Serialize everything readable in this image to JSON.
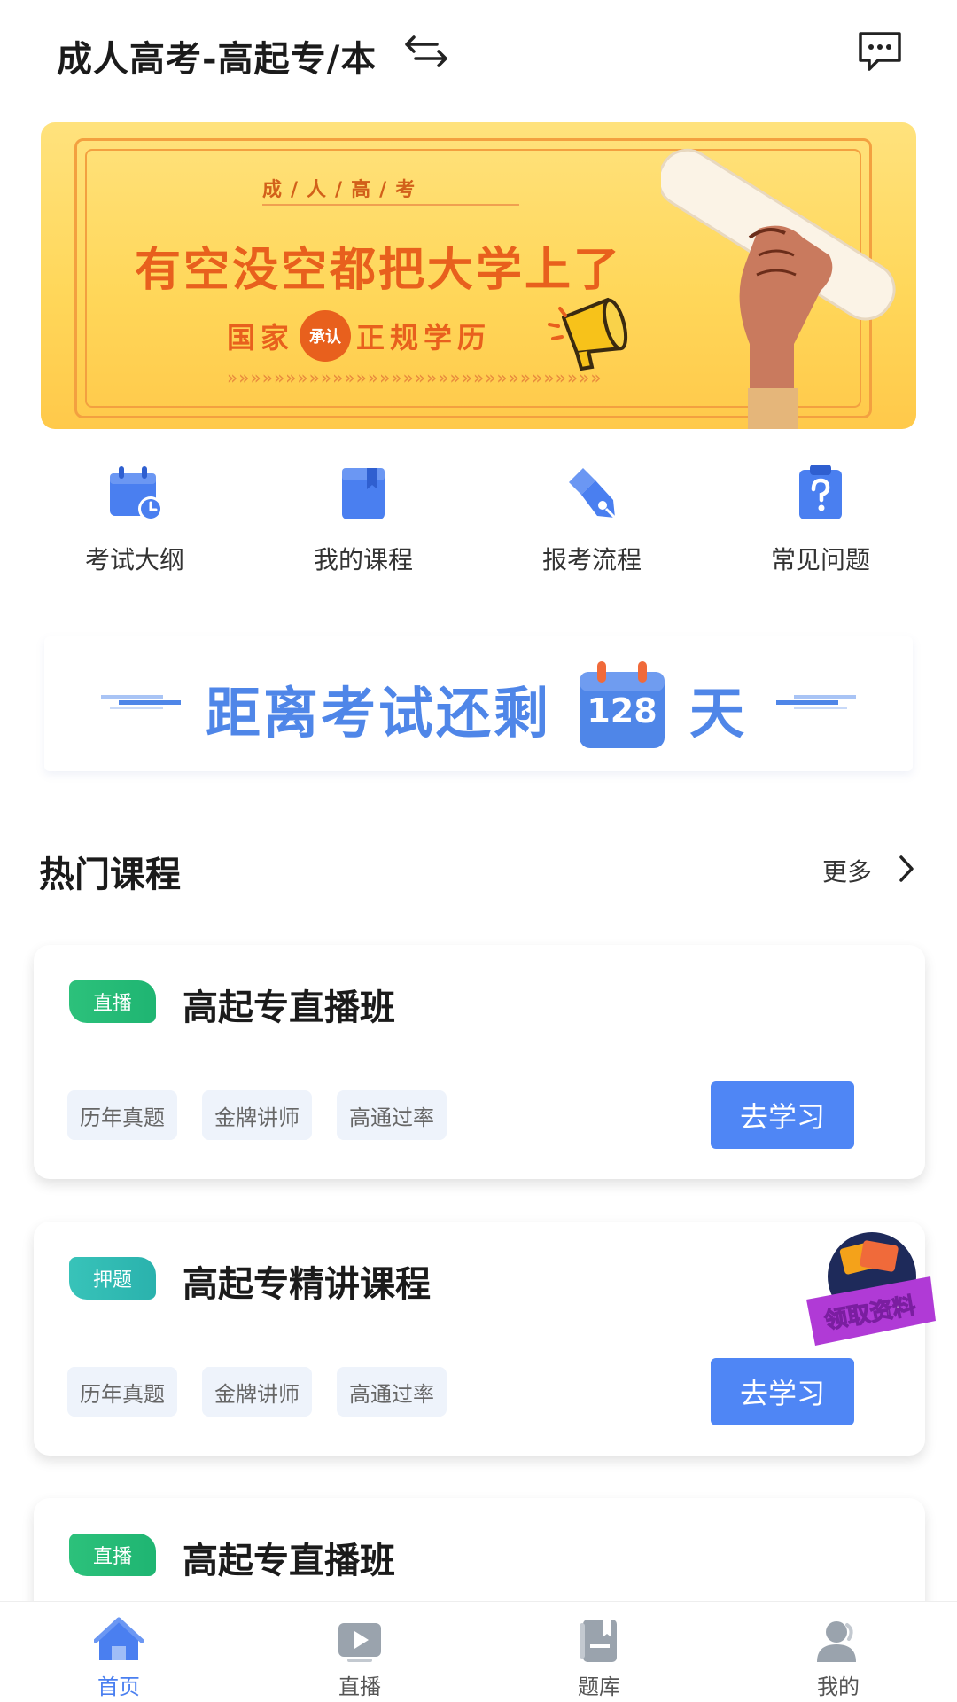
{
  "header": {
    "title": "成人高考-高起专/本",
    "switch_icon": "switch-arrows-icon",
    "message_icon": "message-icon"
  },
  "banner": {
    "top_text": "成/人/高/考",
    "main_text": "有空没空都把大学上了",
    "sub_left": "国家",
    "sub_badge": "承认",
    "sub_right": "正规学历",
    "arrows": "»»»»»»»»»»»»»»»»»»»»»»»»»»»»»»»»"
  },
  "quick_menu": [
    {
      "label": "考试大纲",
      "icon": "calendar-clock-icon"
    },
    {
      "label": "我的课程",
      "icon": "book-icon"
    },
    {
      "label": "报考流程",
      "icon": "pen-icon"
    },
    {
      "label": "常见问题",
      "icon": "question-clipboard-icon"
    }
  ],
  "countdown": {
    "text": "距离考试还剩",
    "days": "128",
    "unit": "天"
  },
  "section": {
    "title": "热门课程",
    "more": "更多"
  },
  "courses": [
    {
      "tag": "直播",
      "title": "高起专直播班",
      "chips": [
        "历年真题",
        "金牌讲师",
        "高通过率"
      ],
      "button": "去学习"
    },
    {
      "tag": "押题",
      "title": "高起专精讲课程",
      "chips": [
        "历年真题",
        "金牌讲师",
        "高通过率"
      ],
      "button": "去学习"
    },
    {
      "tag": "直播",
      "title": "高起专直播班"
    }
  ],
  "float_badge": {
    "label": "领取资料"
  },
  "tabbar": [
    {
      "label": "首页",
      "icon": "home-icon",
      "active": true
    },
    {
      "label": "直播",
      "icon": "play-icon",
      "active": false
    },
    {
      "label": "题库",
      "icon": "question-bank-icon",
      "active": false
    },
    {
      "label": "我的",
      "icon": "user-icon",
      "active": false
    }
  ],
  "colors": {
    "primary": "#4f86f5",
    "banner_bg": "#ffd75a",
    "banner_text": "#e8601d",
    "tag_green": "#1fb572",
    "tag_teal": "#2ab2ad"
  }
}
